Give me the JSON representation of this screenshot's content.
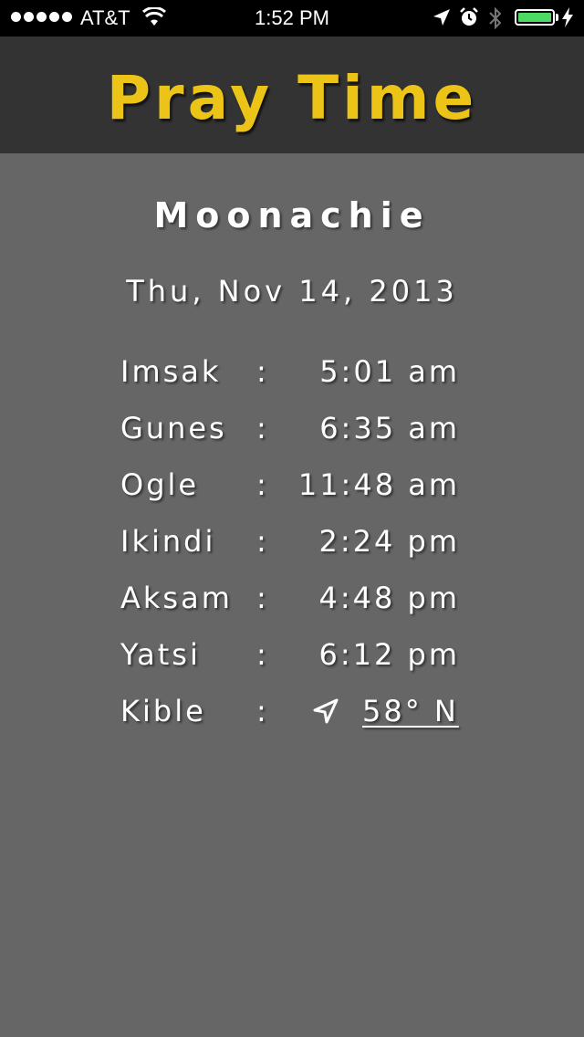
{
  "status_bar": {
    "carrier": "AT&T",
    "time": "1:52 PM",
    "signal_bars": 5,
    "battery_level": 1.0,
    "battery_color": "#4cd964"
  },
  "header": {
    "title": "Pray Time",
    "title_color": "#ecc417"
  },
  "location": {
    "city": "Moonachie",
    "date": "Thu, Nov 14, 2013"
  },
  "prayer_times": [
    {
      "name": "Imsak",
      "separator": ":",
      "time": "5:01 am"
    },
    {
      "name": "Gunes",
      "separator": ":",
      "time": "6:35 am"
    },
    {
      "name": "Ogle",
      "separator": ":",
      "time": "11:48 am"
    },
    {
      "name": "Ikindi",
      "separator": ":",
      "time": "2:24 pm"
    },
    {
      "name": "Aksam",
      "separator": ":",
      "time": "4:48 pm"
    },
    {
      "name": "Yatsi",
      "separator": ":",
      "time": "6:12 pm"
    }
  ],
  "kible": {
    "name": "Kible",
    "separator": ":",
    "icon": "location-arrow-icon",
    "value": "58° N"
  },
  "colors": {
    "background": "#666666",
    "header_background": "#333333",
    "text": "#ffffff"
  }
}
